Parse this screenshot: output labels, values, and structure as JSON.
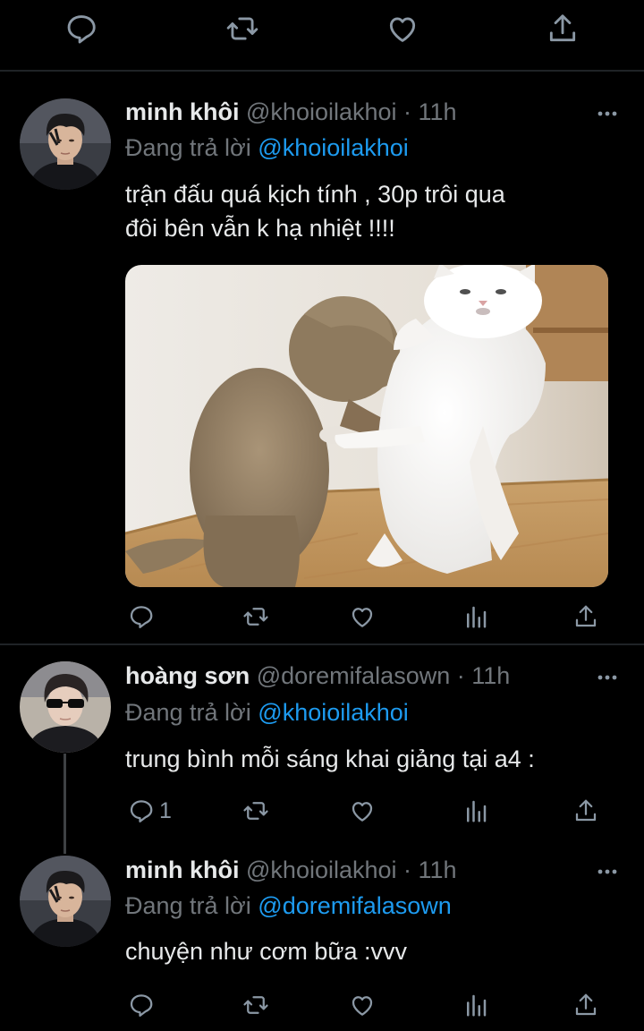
{
  "top_actions": {
    "icons": [
      "reply-icon",
      "retweet-icon",
      "like-icon",
      "share-icon"
    ]
  },
  "tweets": [
    {
      "name": "minh khôi",
      "handle": "@khoioilakhoi",
      "time": "· 11h",
      "reply_prefix": "Đang trả lời",
      "reply_to": "@khoioilakhoi",
      "text_line1": "trận đấu quá kịch tính , 30p trôi qua",
      "text_line2": "đôi bên vẫn k hạ nhiệt !!!!",
      "has_media": true
    },
    {
      "name": "hoàng sơn",
      "handle": "@doremifalasown",
      "time": "· 11h",
      "reply_prefix": "Đang trả lời",
      "reply_to": "@khoioilakhoi",
      "text_line1": "trung bình mỗi sáng khai giảng tại a4 :",
      "reply_count": "1"
    },
    {
      "name": "minh khôi",
      "handle": "@khoioilakhoi",
      "time": "· 11h",
      "reply_prefix": "Đang trả lời",
      "reply_to": "@doremifalasown",
      "text_line1": "chuyện như cơm bữa :vvv"
    }
  ],
  "colors": {
    "mention": "#1d9bf0",
    "muted": "#71767b",
    "background": "#000000"
  }
}
